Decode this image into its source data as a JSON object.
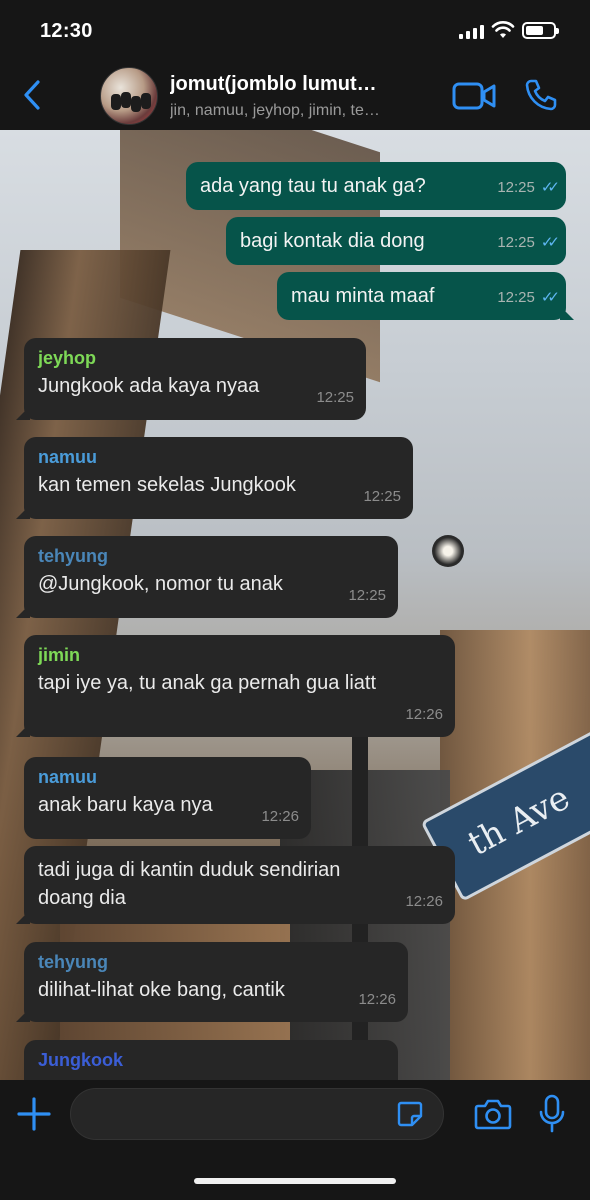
{
  "status_bar": {
    "time": "12:30",
    "battery_icon": "battery-icon",
    "wifi_icon": "wifi-icon",
    "signal_icon": "signal-icon"
  },
  "header": {
    "back_icon": "chevron-left-icon",
    "title": "jomut(jomblo lumut…",
    "subtitle": "jin, namuu, jeyhop, jimin, te…",
    "video_icon": "video-camera-icon",
    "call_icon": "phone-icon"
  },
  "colors": {
    "accent": "#2f8ff3",
    "outgoing_bubble": "#06544a",
    "incoming_bubble": "#262626",
    "read_ticks": "#5fb6f2",
    "sender_jeyhop": "#7ed957",
    "sender_namuu": "#4a9bd8",
    "sender_tehyung": "#4a86b8",
    "sender_jimin": "#7ed957",
    "sender_jungkook": "#3b5ed6"
  },
  "messages": [
    {
      "direction": "out",
      "text": "ada yang tau tu anak ga?",
      "time": "12:25",
      "status": "read"
    },
    {
      "direction": "out",
      "text": "bagi kontak dia dong",
      "time": "12:25",
      "status": "read"
    },
    {
      "direction": "out",
      "text": "mau minta maaf",
      "time": "12:25",
      "status": "read"
    },
    {
      "direction": "in",
      "sender": "jeyhop",
      "text": "Jungkook ada kaya nyaa",
      "time": "12:25"
    },
    {
      "direction": "in",
      "sender": "namuu",
      "text": "kan temen sekelas Jungkook",
      "time": "12:25"
    },
    {
      "direction": "in",
      "sender": "tehyung",
      "text": "@Jungkook, nomor tu anak",
      "time": "12:25"
    },
    {
      "direction": "in",
      "sender": "jimin",
      "text": "tapi iye ya, tu anak ga pernah gua liatt",
      "time": "12:26"
    },
    {
      "direction": "in",
      "sender": "namuu",
      "text": "anak baru kaya nya",
      "time": "12:26"
    },
    {
      "direction": "in",
      "text": "tadi juga di kantin duduk sendirian doang dia",
      "time": "12:26"
    },
    {
      "direction": "in",
      "sender": "tehyung",
      "text": "dilihat-lihat oke bang, cantik",
      "time": "12:26"
    },
    {
      "direction": "in",
      "sender": "Jungkook",
      "text": "",
      "time": ""
    }
  ],
  "input_bar": {
    "plus_icon": "plus-icon",
    "sticker_icon": "sticker-icon",
    "camera_icon": "camera-icon",
    "mic_icon": "microphone-icon",
    "message_value": ""
  },
  "wallpaper": {
    "street_sign_text": "th Ave"
  }
}
